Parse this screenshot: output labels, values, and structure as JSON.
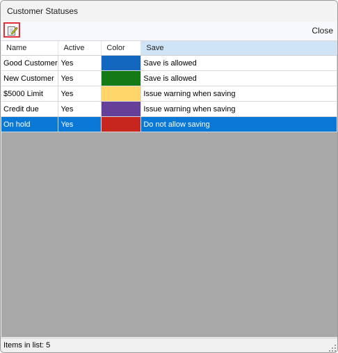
{
  "window": {
    "title": "Customer Statuses"
  },
  "toolbar": {
    "edit_icon": "edit-notepad-icon",
    "close_label": "Close"
  },
  "table": {
    "columns": [
      "Name",
      "Active",
      "Color",
      "Save"
    ],
    "rows": [
      {
        "name": "Good Customer",
        "active": "Yes",
        "color": "#1467be",
        "save": "Save is allowed"
      },
      {
        "name": "New Customer",
        "active": "Yes",
        "color": "#137a16",
        "save": "Save is allowed"
      },
      {
        "name": "$5000 Limit",
        "active": "Yes",
        "color": "#ffd468",
        "save": "Issue warning when saving"
      },
      {
        "name": "Credit due",
        "active": "Yes",
        "color": "#663f99",
        "save": "Issue warning when saving"
      },
      {
        "name": "On hold",
        "active": "Yes",
        "color": "#c6261e",
        "save": "Do not allow saving",
        "selected": true
      }
    ]
  },
  "statusbar": {
    "text": "Items in list: 5"
  },
  "colors": {
    "selection": "#0a78d7",
    "sorted_header": "#cfe4f7",
    "empty_area": "#a8a8a8",
    "highlight_border": "#e0303a"
  }
}
